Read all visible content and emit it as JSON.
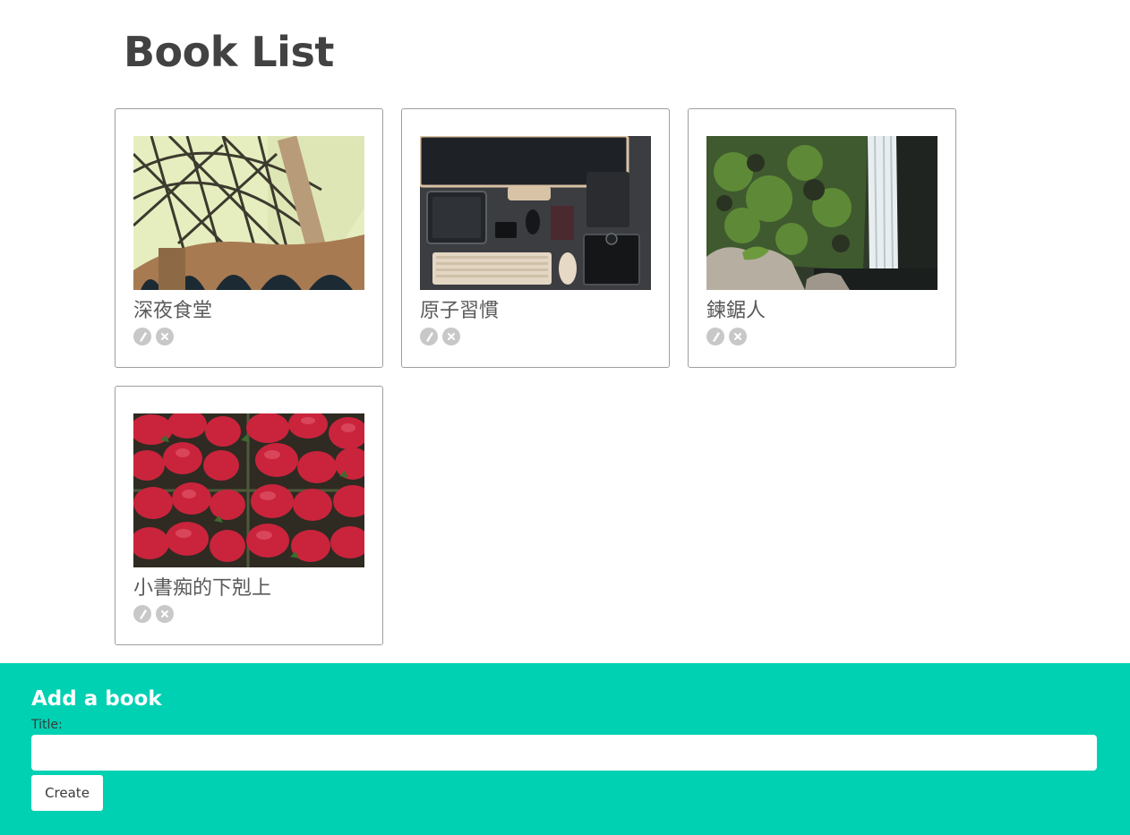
{
  "page": {
    "title": "Book List"
  },
  "books": [
    {
      "title": "深夜食堂",
      "image": "bridge-photo"
    },
    {
      "title": "原子習慣",
      "image": "desk-photo"
    },
    {
      "title": "鍊鋸人",
      "image": "waterfall-photo"
    },
    {
      "title": "小書痴的下剋上",
      "image": "strawberries-photo"
    }
  ],
  "icons": {
    "edit": "edit-icon",
    "delete": "delete-icon"
  },
  "add_form": {
    "heading": "Add a book",
    "title_label": "Title:",
    "title_value": "",
    "title_placeholder": "",
    "create_label": "Create"
  },
  "colors": {
    "accent": "#00d1b2",
    "title_text": "#424242",
    "icon_grey": "#c8c8c8",
    "card_border": "#9e9e9e"
  }
}
